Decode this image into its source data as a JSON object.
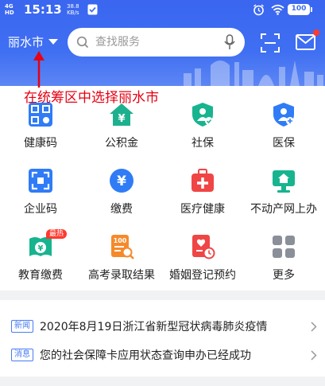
{
  "status_bar": {
    "signal_top": "4G",
    "signal_bottom": "HD",
    "time": "15:13",
    "net_speed_value": "38.8",
    "net_speed_unit": "KB/s",
    "battery": "100"
  },
  "header": {
    "city": "丽水市",
    "search_placeholder": "查找服务",
    "colors": {
      "header_blue": "#3f6ff2",
      "accent_red": "#e60012"
    }
  },
  "annotation": "在统筹区中选择丽水市",
  "services": [
    {
      "label": "健康码",
      "icon": "health-code-icon"
    },
    {
      "label": "公积金",
      "icon": "housing-fund-icon"
    },
    {
      "label": "社保",
      "icon": "social-security-icon"
    },
    {
      "label": "医保",
      "icon": "medical-insurance-icon"
    },
    {
      "label": "企业码",
      "icon": "enterprise-code-icon"
    },
    {
      "label": "缴费",
      "icon": "payment-icon"
    },
    {
      "label": "医疗健康",
      "icon": "medical-kit-icon"
    },
    {
      "label": "不动产网上办",
      "icon": "real-estate-icon"
    },
    {
      "label": "教育缴费",
      "icon": "education-payment-icon",
      "badge": "最热"
    },
    {
      "label": "高考录取结果",
      "icon": "exam-results-icon"
    },
    {
      "label": "婚姻登记预约",
      "icon": "marriage-registration-icon"
    },
    {
      "label": "更多",
      "icon": "more-grid-icon"
    }
  ],
  "news": [
    {
      "tag": "新闻",
      "text": "2020年8月19日浙江省新型冠状病毒肺炎疫情"
    },
    {
      "tag": "消息",
      "text": "您的社会保障卡应用状态查询申办已经成功"
    }
  ]
}
